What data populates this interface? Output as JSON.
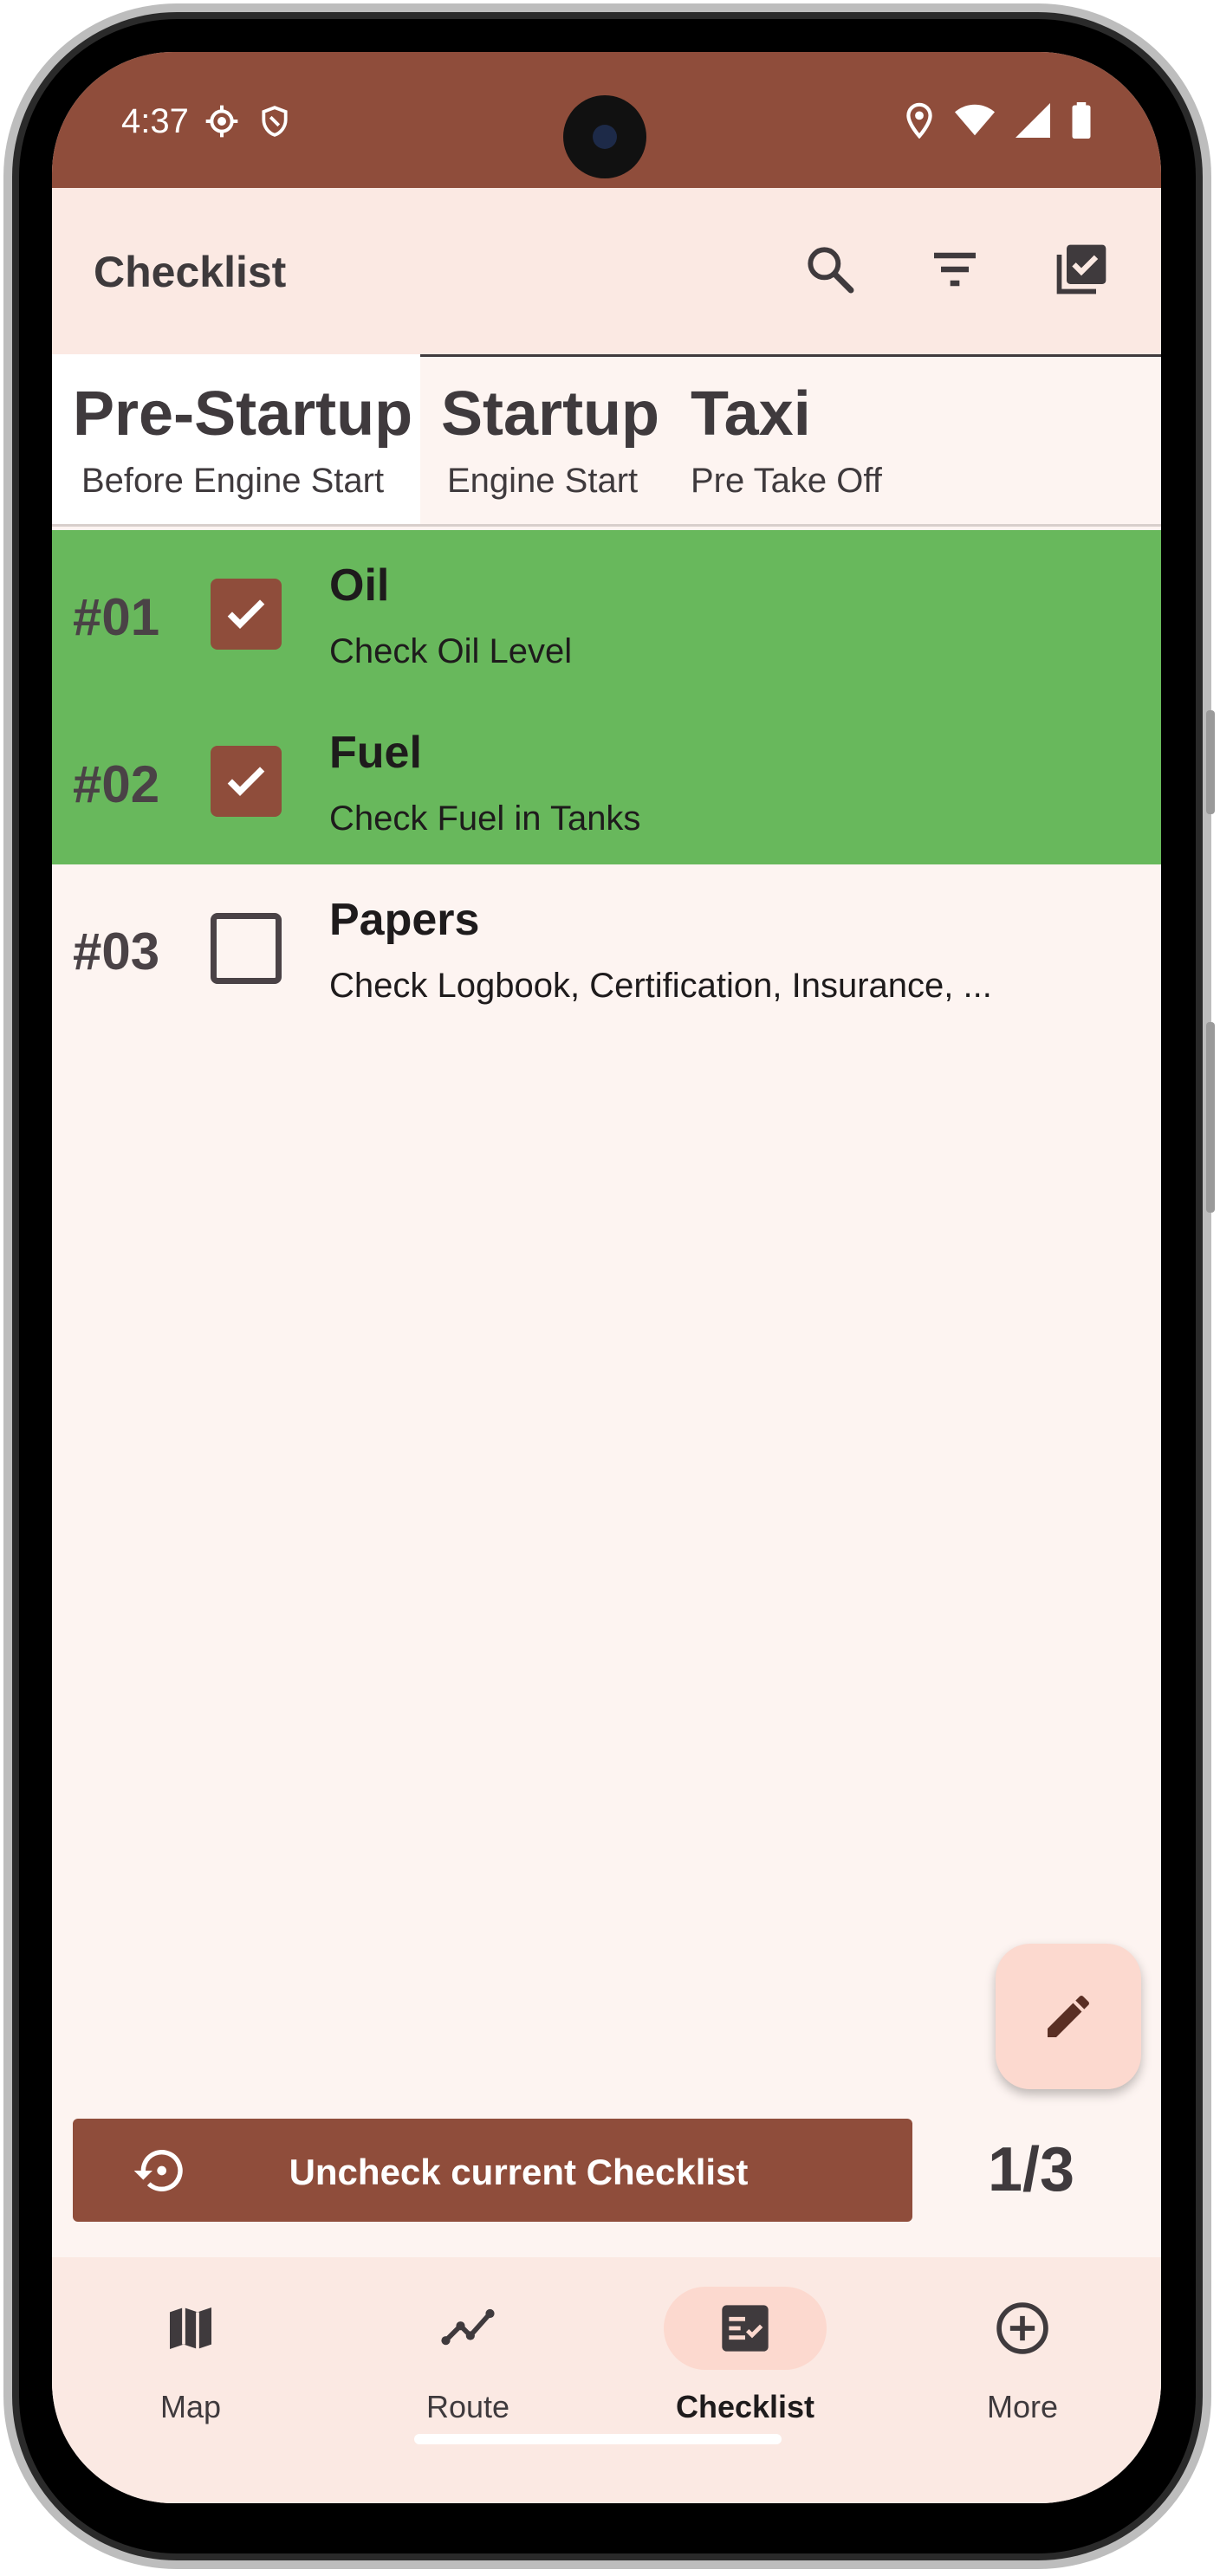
{
  "status_bar": {
    "time": "4:37"
  },
  "app_bar": {
    "title": "Checklist",
    "actions": [
      "search-icon",
      "filter-icon",
      "checklist-select-icon"
    ]
  },
  "tabs": [
    {
      "title": "Pre-Startup",
      "subtitle": "Before Engine Start",
      "active": true
    },
    {
      "title": "Startup",
      "subtitle": "Engine Start",
      "active": false
    },
    {
      "title": "Taxi",
      "subtitle": "Pre Take Off",
      "active": false
    }
  ],
  "checklist": [
    {
      "number": "#01",
      "title": "Oil",
      "description": "Check Oil Level",
      "checked": true
    },
    {
      "number": "#02",
      "title": "Fuel",
      "description": "Check Fuel in Tanks",
      "checked": true
    },
    {
      "number": "#03",
      "title": "Papers",
      "description": "Check Logbook, Certification, Insurance, ...",
      "checked": false
    }
  ],
  "actions": {
    "uncheck_label": "Uncheck current Checklist",
    "counter": "1/3"
  },
  "bottom_nav": [
    {
      "label": "Map",
      "icon": "map-icon",
      "active": false
    },
    {
      "label": "Route",
      "icon": "route-icon",
      "active": false
    },
    {
      "label": "Checklist",
      "icon": "checklist-icon",
      "active": true
    },
    {
      "label": "More",
      "icon": "add-circle-icon",
      "active": false
    }
  ],
  "colors": {
    "primary": "#8f4d3b",
    "checked_row": "#68b85c",
    "surface": "#fdf4f1",
    "app_bar": "#fbe9e3",
    "fab": "#fcd9cf"
  }
}
